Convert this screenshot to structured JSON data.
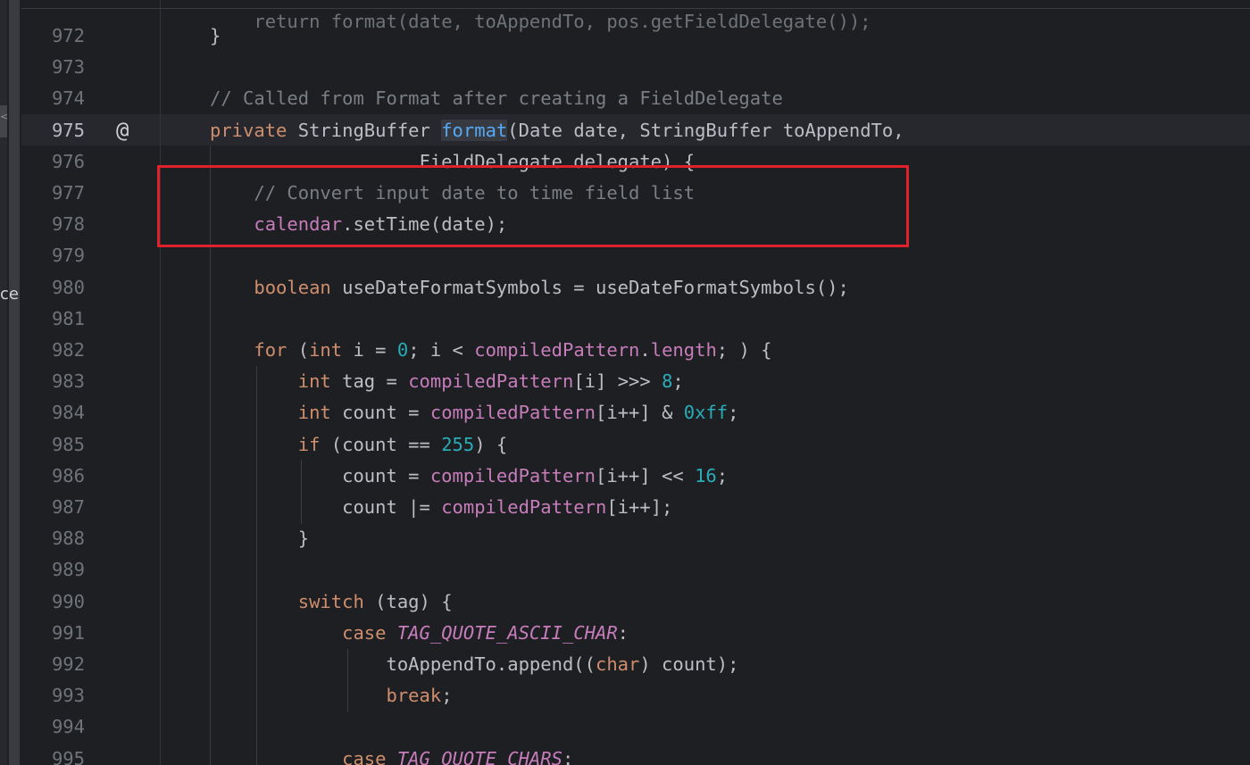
{
  "editor": {
    "top_partial_line": "return format(date, toAppendTo, pos.getFieldDelegate());",
    "clipped_side_text": "cer",
    "left_tab_glyph": "<",
    "current_line_marker": "@",
    "lines": [
      {
        "number": "972",
        "tokens": [
          {
            "t": "}",
            "c": ""
          }
        ]
      },
      {
        "number": "973",
        "tokens": []
      },
      {
        "number": "974",
        "tokens": [
          {
            "t": "// Called from Format after creating a FieldDelegate",
            "c": "cm"
          }
        ]
      },
      {
        "number": "975",
        "tokens": [
          {
            "t": "private ",
            "c": "kw"
          },
          {
            "t": "StringBuffer ",
            "c": ""
          },
          {
            "t": "format",
            "c": "fn hl"
          },
          {
            "t": "(Date date, StringBuffer toAppendTo,",
            "c": ""
          }
        ]
      },
      {
        "number": "976",
        "tokens": [
          {
            "t": "                   FieldDelegate delegate) {",
            "c": ""
          }
        ]
      },
      {
        "number": "977",
        "tokens": [
          {
            "t": "    ",
            "c": ""
          },
          {
            "t": "// Convert input date to time field list",
            "c": "cm"
          }
        ]
      },
      {
        "number": "978",
        "tokens": [
          {
            "t": "    ",
            "c": ""
          },
          {
            "t": "calendar",
            "c": "fld"
          },
          {
            "t": ".setTime(date);",
            "c": ""
          }
        ]
      },
      {
        "number": "979",
        "tokens": []
      },
      {
        "number": "980",
        "tokens": [
          {
            "t": "    ",
            "c": ""
          },
          {
            "t": "boolean ",
            "c": "kw"
          },
          {
            "t": "useDateFormatSymbols = useDateFormatSymbols();",
            "c": ""
          }
        ]
      },
      {
        "number": "981",
        "tokens": []
      },
      {
        "number": "982",
        "tokens": [
          {
            "t": "    ",
            "c": ""
          },
          {
            "t": "for ",
            "c": "kw"
          },
          {
            "t": "(",
            "c": ""
          },
          {
            "t": "int ",
            "c": "kw"
          },
          {
            "t": "i = ",
            "c": ""
          },
          {
            "t": "0",
            "c": "num"
          },
          {
            "t": "; i < ",
            "c": ""
          },
          {
            "t": "compiledPattern",
            "c": "fld"
          },
          {
            "t": ".",
            "c": ""
          },
          {
            "t": "length",
            "c": "fld"
          },
          {
            "t": "; ) {",
            "c": ""
          }
        ]
      },
      {
        "number": "983",
        "tokens": [
          {
            "t": "        ",
            "c": ""
          },
          {
            "t": "int ",
            "c": "kw"
          },
          {
            "t": "tag = ",
            "c": ""
          },
          {
            "t": "compiledPattern",
            "c": "fld"
          },
          {
            "t": "[i] >>> ",
            "c": ""
          },
          {
            "t": "8",
            "c": "num"
          },
          {
            "t": ";",
            "c": ""
          }
        ]
      },
      {
        "number": "984",
        "tokens": [
          {
            "t": "        ",
            "c": ""
          },
          {
            "t": "int ",
            "c": "kw"
          },
          {
            "t": "count = ",
            "c": ""
          },
          {
            "t": "compiledPattern",
            "c": "fld"
          },
          {
            "t": "[i++] & ",
            "c": ""
          },
          {
            "t": "0xff",
            "c": "num"
          },
          {
            "t": ";",
            "c": ""
          }
        ]
      },
      {
        "number": "985",
        "tokens": [
          {
            "t": "        ",
            "c": ""
          },
          {
            "t": "if ",
            "c": "kw"
          },
          {
            "t": "(count == ",
            "c": ""
          },
          {
            "t": "255",
            "c": "num"
          },
          {
            "t": ") {",
            "c": ""
          }
        ]
      },
      {
        "number": "986",
        "tokens": [
          {
            "t": "            count = ",
            "c": ""
          },
          {
            "t": "compiledPattern",
            "c": "fld"
          },
          {
            "t": "[i++] << ",
            "c": ""
          },
          {
            "t": "16",
            "c": "num"
          },
          {
            "t": ";",
            "c": ""
          }
        ]
      },
      {
        "number": "987",
        "tokens": [
          {
            "t": "            count |= ",
            "c": ""
          },
          {
            "t": "compiledPattern",
            "c": "fld"
          },
          {
            "t": "[i++];",
            "c": ""
          }
        ]
      },
      {
        "number": "988",
        "tokens": [
          {
            "t": "        }",
            "c": ""
          }
        ]
      },
      {
        "number": "989",
        "tokens": []
      },
      {
        "number": "990",
        "tokens": [
          {
            "t": "        ",
            "c": ""
          },
          {
            "t": "switch ",
            "c": "kw"
          },
          {
            "t": "(tag) {",
            "c": ""
          }
        ]
      },
      {
        "number": "991",
        "tokens": [
          {
            "t": "            ",
            "c": ""
          },
          {
            "t": "case ",
            "c": "kw"
          },
          {
            "t": "TAG_QUOTE_ASCII_CHAR",
            "c": "const"
          },
          {
            "t": ":",
            "c": ""
          }
        ]
      },
      {
        "number": "992",
        "tokens": [
          {
            "t": "                toAppendTo.append((",
            "c": ""
          },
          {
            "t": "char",
            "c": "kw"
          },
          {
            "t": ") count);",
            "c": ""
          }
        ]
      },
      {
        "number": "993",
        "tokens": [
          {
            "t": "                ",
            "c": ""
          },
          {
            "t": "break",
            "c": "kw"
          },
          {
            "t": ";",
            "c": ""
          }
        ]
      },
      {
        "number": "994",
        "tokens": []
      },
      {
        "number": "995",
        "tokens": [
          {
            "t": "            ",
            "c": ""
          },
          {
            "t": "case ",
            "c": "kw"
          },
          {
            "t": "TAG_QUOTE_CHARS",
            "c": "const"
          },
          {
            "t": ":",
            "c": ""
          }
        ]
      }
    ]
  },
  "colors": {
    "background": "#1e1f22",
    "keyword": "#cf8e6d",
    "comment": "#7a7e85",
    "number": "#2aacb8",
    "field": "#c77dbb",
    "function": "#56a8f5",
    "annotation_box": "#e0212c"
  }
}
